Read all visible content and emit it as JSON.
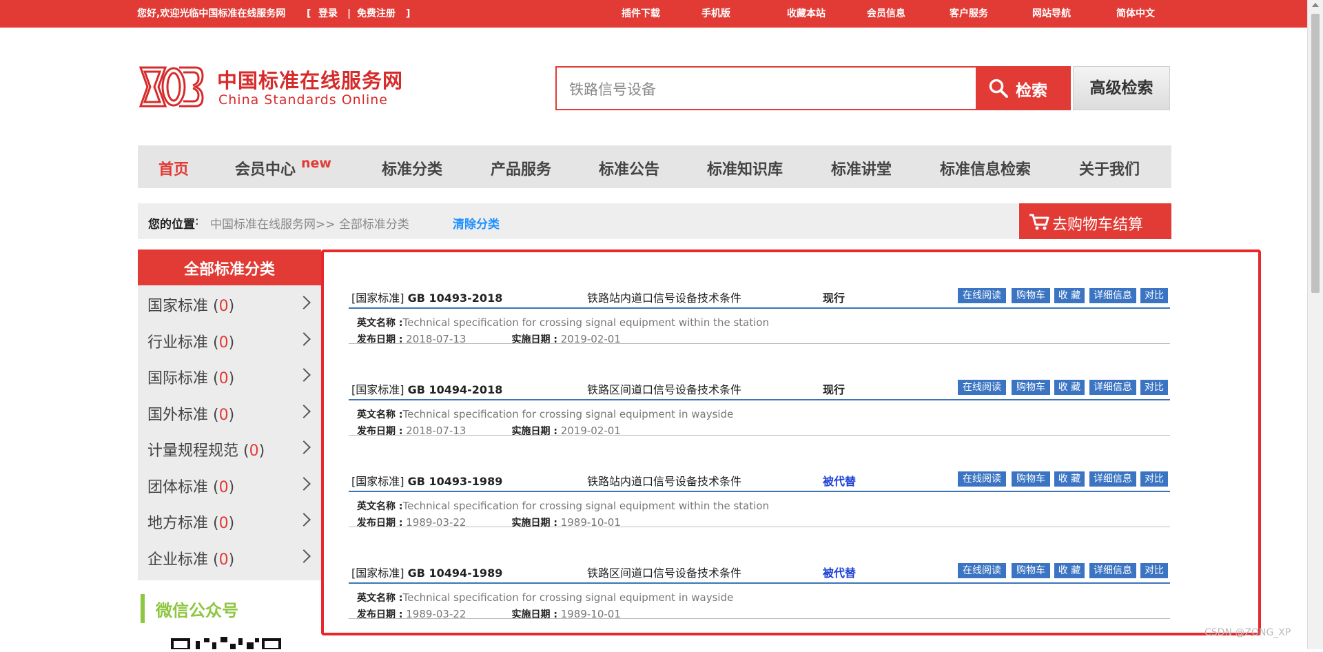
{
  "topbar": {
    "welcome": "您好,欢迎光临中国标准在线服务网",
    "bracket_open": "[",
    "login": "登录",
    "sep": "|",
    "register": "免费注册",
    "bracket_close": "]",
    "links": [
      "插件下载",
      "手机版",
      "收藏本站",
      "会员信息",
      "客户服务",
      "网站导航",
      "简体中文"
    ]
  },
  "logo": {
    "cn": "中国标准在线服务网",
    "en": "China Standards Online"
  },
  "search": {
    "value": "铁路信号设备",
    "button": "检索",
    "advanced": "高级检索"
  },
  "nav": {
    "items": [
      "首页",
      "会员中心",
      "标准分类",
      "产品服务",
      "标准公告",
      "标准知识库",
      "标准讲堂",
      "标准信息检索",
      "关于我们"
    ],
    "new_badge": "new",
    "active_color": "#e23a34"
  },
  "breadcrumb": {
    "label": "您的位置",
    "colon": ":",
    "path": "中国标准在线服务网>> 全部标准分类",
    "clear": "清除分类",
    "cart": "去购物车结算"
  },
  "sidebar": {
    "title": "全部标准分类",
    "categories": [
      {
        "name": "国家标准",
        "count": "0"
      },
      {
        "name": "行业标准",
        "count": "0"
      },
      {
        "name": "国际标准",
        "count": "0"
      },
      {
        "name": "国外标准",
        "count": "0"
      },
      {
        "name": "计量规程规范",
        "count": "0"
      },
      {
        "name": "团体标准",
        "count": "0"
      },
      {
        "name": "地方标准",
        "count": "0"
      },
      {
        "name": "企业标准",
        "count": "0"
      }
    ],
    "wechat": "微信公众号"
  },
  "results": {
    "actions": [
      "在线阅读",
      "购物车",
      "收 藏",
      "详细信息",
      "对比"
    ],
    "en_label": "英文名称 :",
    "pub_label": "发布日期 :",
    "impl_label": "实施日期 :",
    "rows": [
      {
        "type": "[国家标准]",
        "code": "GB 10493-2018",
        "title": "铁路站内道口信号设备技术条件",
        "status": "现行",
        "status_color": "#222222",
        "en": "Technical specification for crossing signal equipment within the station",
        "pub": "2018-07-13",
        "impl": "2019-02-01"
      },
      {
        "type": "[国家标准]",
        "code": "GB 10494-2018",
        "title": "铁路区间道口信号设备技术条件",
        "status": "现行",
        "status_color": "#222222",
        "en": "Technical specification for crossing signal equipment in wayside",
        "pub": "2018-07-13",
        "impl": "2019-02-01"
      },
      {
        "type": "[国家标准]",
        "code": "GB 10493-1989",
        "title": "铁路站内道口信号设备技术条件",
        "status": "被代替",
        "status_color": "#1a3fd6",
        "en": "Technical specification for crossing signal equipment within the station",
        "pub": "1989-03-22",
        "impl": "1989-10-01"
      },
      {
        "type": "[国家标准]",
        "code": "GB 10494-1989",
        "title": "铁路区间道口信号设备技术条件",
        "status": "被代替",
        "status_color": "#1a3fd6",
        "en": "Technical specification for crossing signal equipment in wayside",
        "pub": "1989-03-22",
        "impl": "1989-10-01"
      }
    ]
  },
  "watermark": "CSDN @ZONG_XP",
  "colors": {
    "brand_red": "#e23a34",
    "action_blue": "#3a74c2",
    "link_blue": "#1e90ff",
    "wechat_green": "#8dc63f"
  }
}
